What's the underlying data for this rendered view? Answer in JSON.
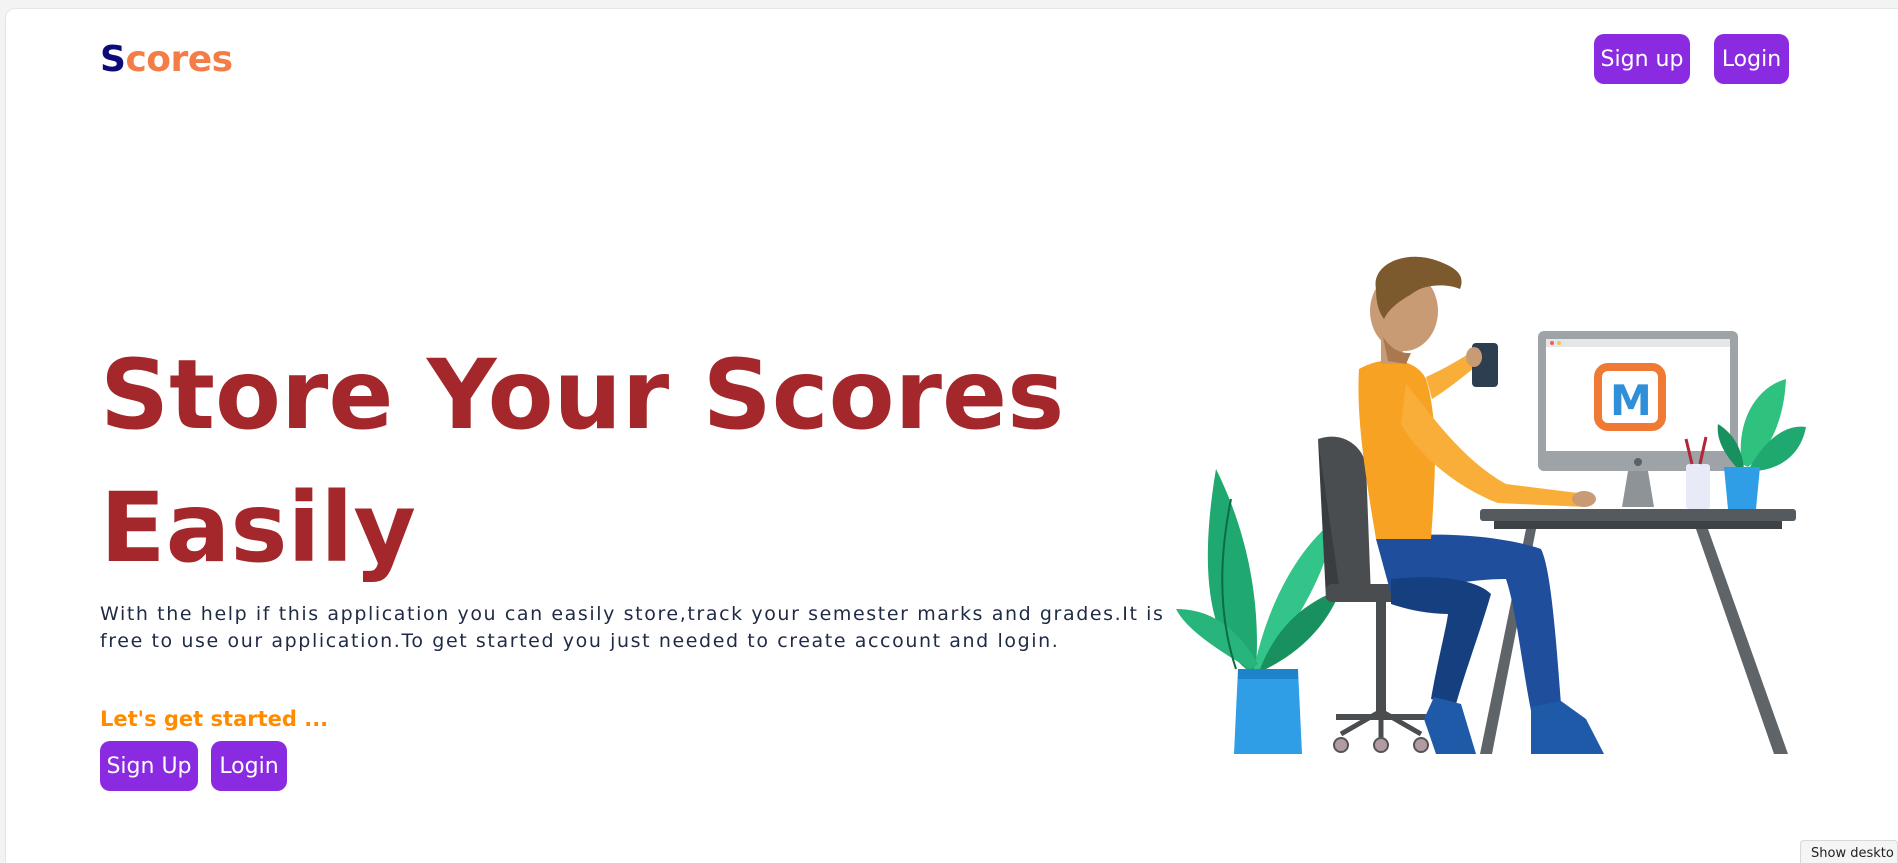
{
  "header": {
    "logo_first": "S",
    "logo_rest": "cores",
    "signup_label": "Sign up",
    "login_label": "Login"
  },
  "hero": {
    "title_line1": "Store Your Scores",
    "title_line2": "Easily",
    "description_line1": "With the help if this application you can easily store,track your semester marks and grades.It is",
    "description_line2": "free to use our application.To get started you just needed to create account and login.",
    "cta_label": "Let's get started ...",
    "signup_label": "Sign Up",
    "login_label": "Login"
  },
  "illustration": {
    "monitor_logo": "M"
  },
  "overlay": {
    "desktop_tab": "Show deskto"
  },
  "colors": {
    "brand_dark": "#0b0b7a",
    "brand_orange": "#f47c46",
    "button": "#8a2be2",
    "title": "#a4282b",
    "cta": "#ff8c00"
  }
}
